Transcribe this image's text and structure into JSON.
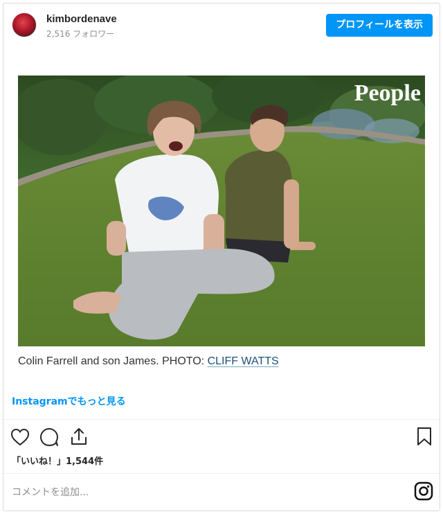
{
  "header": {
    "username": "kimbordenave",
    "followers": "2,516 フォロワー",
    "profile_button": "プロフィールを表示"
  },
  "media": {
    "watermark": "People"
  },
  "caption": {
    "text": "Colin Farrell and son James. PHOTO: ",
    "credit": "CLIFF WATTS"
  },
  "instagram_link": "Instagramでもっと見る",
  "actions": {
    "like_icon": "heart-icon",
    "comment_icon": "comment-icon",
    "share_icon": "share-icon",
    "save_icon": "bookmark-icon"
  },
  "likes": "「いいね！」1,544件",
  "comment": {
    "placeholder": "コメントを追加..."
  },
  "footer_icon": "instagram-icon",
  "colors": {
    "accent": "#0095f6",
    "text": "#262626",
    "muted": "#8e8e8e",
    "border": "#dbdbdb"
  }
}
